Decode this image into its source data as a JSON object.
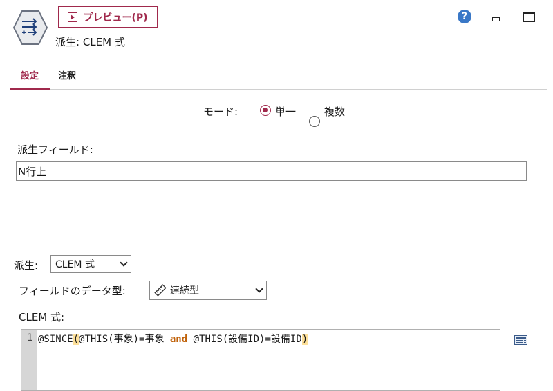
{
  "header": {
    "preview_label": "プレビュー(P)",
    "node_title": "派生: CLEM 式",
    "help_glyph": "?",
    "icons": [
      "derive-node-icon",
      "play-icon",
      "help-icon",
      "minimize-icon",
      "maximize-icon"
    ]
  },
  "tabs": [
    {
      "label": "設定",
      "active": true
    },
    {
      "label": "注釈",
      "active": false
    }
  ],
  "mode": {
    "label": "モード:",
    "options": [
      {
        "label": "単一",
        "checked": true
      },
      {
        "label": "複数",
        "checked": false
      }
    ]
  },
  "derive_field": {
    "label": "派生フィールド:",
    "value": "N行上"
  },
  "derive_as": {
    "label": "派生:",
    "value": "CLEM 式"
  },
  "field_type": {
    "label": "フィールドのデータ型:",
    "value": "連続型",
    "icon": "continuous-ruler-icon"
  },
  "clem": {
    "label": "CLEM 式:",
    "line_number": "1",
    "code_prefix": "@SINCE",
    "open_paren": "(",
    "code_middle_1": "@THIS(事象)=事象 ",
    "keyword": "and",
    "code_middle_2": " @THIS(設備ID)=設備ID",
    "close_paren": ")",
    "calculator_icon": "expression-builder-icon"
  },
  "colors": {
    "accent": "#a0294c",
    "help": "#3a78c7",
    "keyword": "#c0620a",
    "paren_highlight": "#fde09a"
  }
}
